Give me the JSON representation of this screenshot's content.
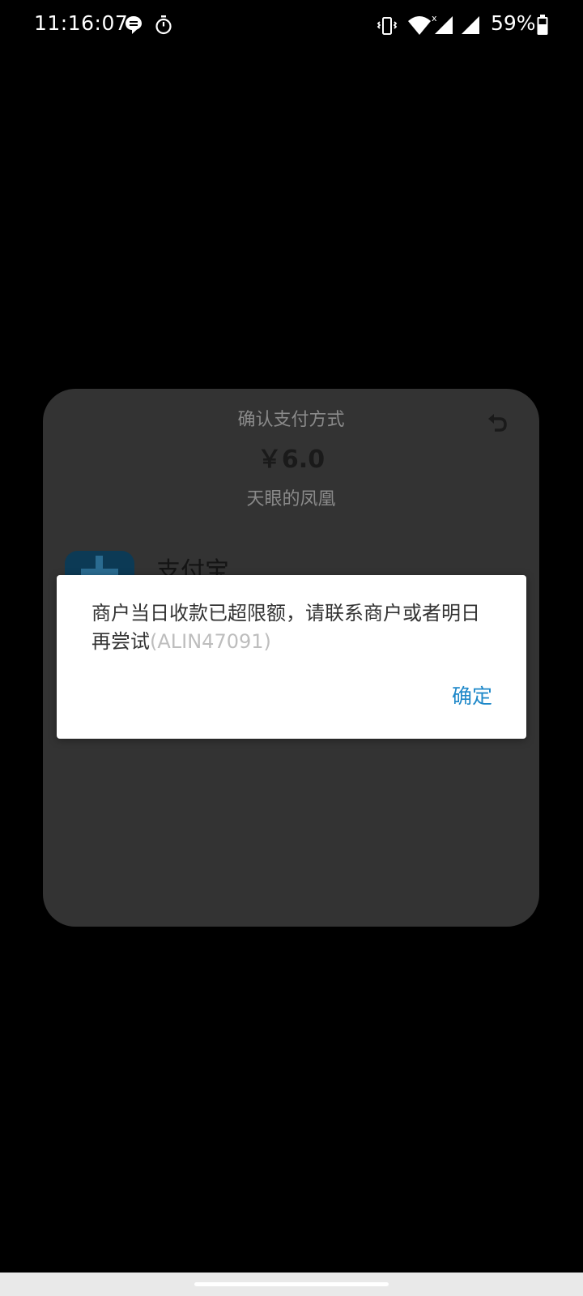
{
  "status_bar": {
    "time": "11:16:07",
    "battery_percent": "59%",
    "icons": [
      "chat-bubble-icon",
      "stopwatch-icon",
      "vibrate-icon",
      "wifi-icon",
      "signal-icon",
      "signal-icon",
      "battery-icon"
    ]
  },
  "sheet": {
    "title": "确认支付方式",
    "amount": "￥6.0",
    "merchant": "天眼的凤凰",
    "payment_option_label": "支付宝"
  },
  "dialog": {
    "message": "商户当日收款已超限额，请联系商户或者明日再尝试",
    "error_code": "(ALIN47091)",
    "confirm_label": "确定"
  },
  "colors": {
    "background": "#000000",
    "sheet": "#333333",
    "dialog": "#ffffff",
    "accent": "#1e88c9"
  }
}
